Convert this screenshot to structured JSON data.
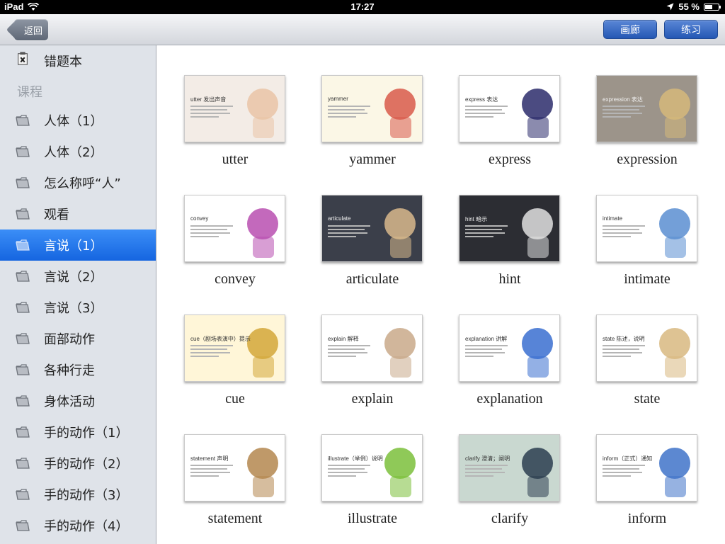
{
  "status_bar": {
    "device": "iPad",
    "time": "17:27",
    "battery_text": "55 %",
    "battery_level": 0.55
  },
  "nav": {
    "back_label": "返回",
    "gallery_label": "画廊",
    "practice_label": "练习"
  },
  "sidebar": {
    "wrongbook_label": "错题本",
    "section_label": "课程",
    "items": [
      {
        "label": "人体（1）",
        "selected": false
      },
      {
        "label": "人体（2）",
        "selected": false
      },
      {
        "label": "怎么称呼“人”",
        "selected": false
      },
      {
        "label": "观看",
        "selected": false
      },
      {
        "label": "言说（1）",
        "selected": true
      },
      {
        "label": "言说（2）",
        "selected": false
      },
      {
        "label": "言说（3）",
        "selected": false
      },
      {
        "label": "面部动作",
        "selected": false
      },
      {
        "label": "各种行走",
        "selected": false
      },
      {
        "label": "身体活动",
        "selected": false
      },
      {
        "label": "手的动作（1）",
        "selected": false
      },
      {
        "label": "手的动作（2）",
        "selected": false
      },
      {
        "label": "手的动作（3）",
        "selected": false
      },
      {
        "label": "手的动作（4）",
        "selected": false
      }
    ]
  },
  "cards": [
    {
      "word": "utter",
      "thumb_title": "utter 发出声音",
      "bg": "#f3ece6",
      "accent": "#e9c4a6"
    },
    {
      "word": "yammer",
      "thumb_title": "yammer",
      "bg": "#fbf7e6",
      "accent": "#d85a4a"
    },
    {
      "word": "express",
      "thumb_title": "express 表达",
      "bg": "#ffffff",
      "accent": "#2b2c6b"
    },
    {
      "word": "expression",
      "thumb_title": "expression 表达",
      "bg": "#9c948a",
      "accent": "#d6b87a"
    },
    {
      "word": "convey",
      "thumb_title": "convey",
      "bg": "#ffffff",
      "accent": "#b84fb0"
    },
    {
      "word": "articulate",
      "thumb_title": "articulate",
      "bg": "#3b3f4a",
      "accent": "#d9b98c"
    },
    {
      "word": "hint",
      "thumb_title": "hint 暗示",
      "bg": "#2c2d33",
      "accent": "#e0e0e0"
    },
    {
      "word": "intimate",
      "thumb_title": "intimate",
      "bg": "#ffffff",
      "accent": "#5a8ed1"
    },
    {
      "word": "cue",
      "thumb_title": "cue（剧场表演中）提示",
      "bg": "#fff6d8",
      "accent": "#d4a73a"
    },
    {
      "word": "explain",
      "thumb_title": "explain 解释",
      "bg": "#ffffff",
      "accent": "#c9a98a"
    },
    {
      "word": "explanation",
      "thumb_title": "explanation 讲解",
      "bg": "#ffffff",
      "accent": "#3a6fd0"
    },
    {
      "word": "state",
      "thumb_title": "state 陈述，说明",
      "bg": "#ffffff",
      "accent": "#d8b880"
    },
    {
      "word": "statement",
      "thumb_title": "statement 声明",
      "bg": "#ffffff",
      "accent": "#b4874f"
    },
    {
      "word": "illustrate",
      "thumb_title": "illustrate（举例）说明",
      "bg": "#ffffff",
      "accent": "#7bbf3b"
    },
    {
      "word": "clarify",
      "thumb_title": "clarify 澄清；阐明",
      "bg": "#c9d8d0",
      "accent": "#2c3e50"
    },
    {
      "word": "inform",
      "thumb_title": "inform（正式）通知",
      "bg": "#ffffff",
      "accent": "#3f73c9"
    }
  ]
}
